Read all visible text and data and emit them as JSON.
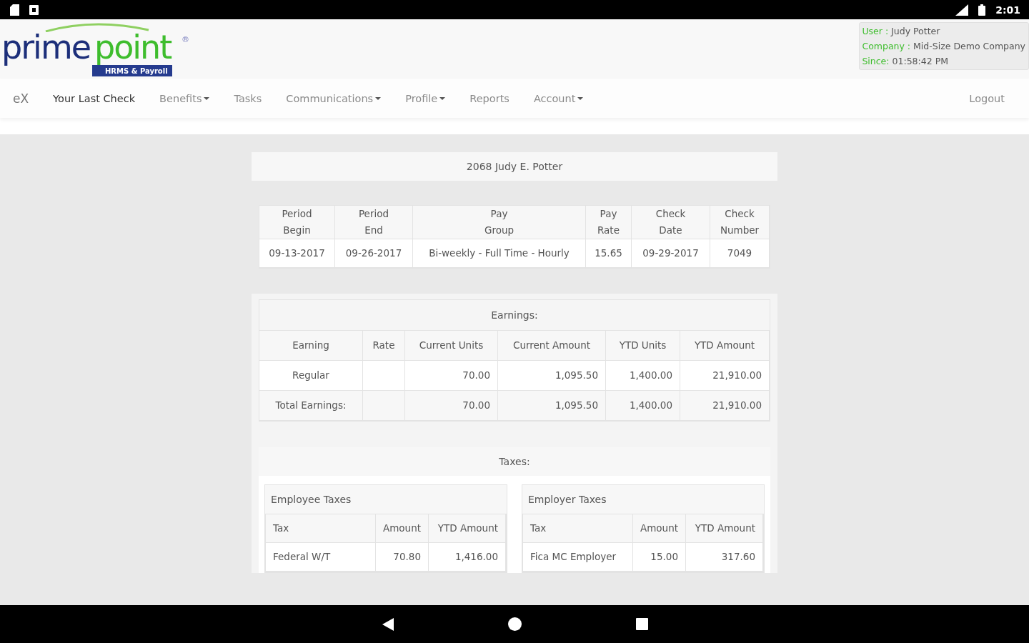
{
  "status_bar": {
    "time": "2:01"
  },
  "header": {
    "logo": {
      "word_1": "prime",
      "word_2": "point",
      "mark": "®",
      "tagline": "HRMS & Payroll"
    },
    "session": [
      {
        "label": "User :",
        "value": "Judy Potter"
      },
      {
        "label": "Company :",
        "value": "Mid-Size Demo Company"
      },
      {
        "label": "Since:",
        "value": "01:58:42 PM"
      }
    ]
  },
  "nav": {
    "brand": "eX",
    "items": [
      {
        "label": "Your Last Check",
        "kind": "link",
        "selected": true
      },
      {
        "label": "Benefits",
        "kind": "dropdown",
        "selected": false
      },
      {
        "label": "Tasks",
        "kind": "link",
        "selected": false
      },
      {
        "label": "Communications",
        "kind": "dropdown",
        "selected": false
      },
      {
        "label": "Profile",
        "kind": "dropdown",
        "selected": false
      },
      {
        "label": "Reports",
        "kind": "link",
        "selected": false
      },
      {
        "label": "Account",
        "kind": "dropdown",
        "selected": false
      }
    ],
    "logout": "Logout"
  },
  "check_title": "2068 Judy E. Potter",
  "summary": {
    "columns": [
      "Period\nBegin",
      "Period\nEnd",
      "Pay\nGroup",
      "Pay\nRate",
      "Check\nDate",
      "Check\nNumber"
    ],
    "rows": [
      [
        "09-13-2017",
        "09-26-2017",
        "Bi-weekly - Full Time - Hourly",
        "15.65",
        "09-29-2017",
        "7049"
      ]
    ]
  },
  "earnings": {
    "title": "Earnings:",
    "columns": [
      "Earning",
      "Rate",
      "Current Units",
      "Current Amount",
      "YTD Units",
      "YTD Amount"
    ],
    "rows": [
      [
        "Regular",
        null,
        "70.00",
        "1,095.50",
        "1,400.00",
        "21,910.00"
      ],
      [
        "Total Earnings:",
        null,
        "70.00",
        "1,095.50",
        "1,400.00",
        "21,910.00"
      ]
    ]
  },
  "taxes": {
    "title": "Taxes:",
    "panels": [
      {
        "title": "Employee Taxes",
        "columns": [
          "Tax",
          "Amount",
          "YTD Amount"
        ],
        "rows": [
          [
            "Federal W/T",
            "70.80",
            "1,416.00"
          ]
        ]
      },
      {
        "title": "Employer Taxes",
        "columns": [
          "Tax",
          "Amount",
          "YTD Amount"
        ],
        "rows": [
          [
            "Fica MC Employer",
            "15.00",
            "317.60"
          ]
        ]
      }
    ]
  }
}
